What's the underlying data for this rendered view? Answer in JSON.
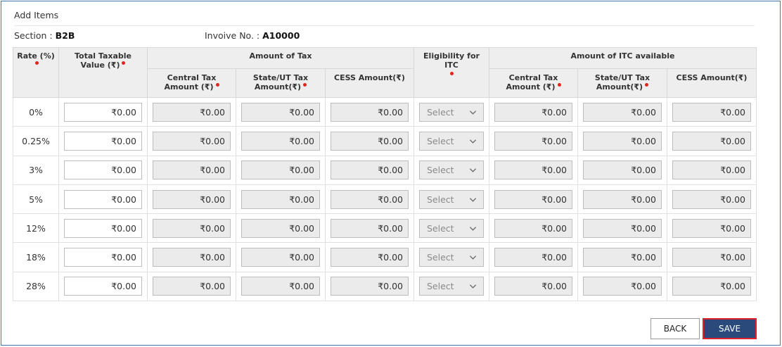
{
  "panel": {
    "title": "Add Items"
  },
  "meta": {
    "section_label": "Section : ",
    "section_value": "B2B",
    "invoice_label": "Invoive No. : ",
    "invoice_value": "A10000"
  },
  "columns": {
    "rate": "Rate (%)",
    "taxable": "Total Taxable Value (₹)",
    "amount_of_tax": "Amount of Tax",
    "eligibility": "Eligibility for ITC",
    "itc_available": "Amount of ITC available",
    "central_tax": "Central Tax Amount (₹)",
    "state_tax": "State/UT Tax Amount(₹)",
    "cess": "CESS Amount(₹)",
    "itc_central_tax": "Central Tax Amount (₹)",
    "itc_state_tax": "State/UT Tax Amount(₹)",
    "itc_cess": "CESS Amount(₹)"
  },
  "rows": [
    {
      "rate": "0%",
      "taxable": "₹0.00",
      "central": "₹0.00",
      "state": "₹0.00",
      "cess": "₹0.00",
      "eligibility": "Select",
      "itc_central": "₹0.00",
      "itc_state": "₹0.00",
      "itc_cess": "₹0.00"
    },
    {
      "rate": "0.25%",
      "taxable": "₹0.00",
      "central": "₹0.00",
      "state": "₹0.00",
      "cess": "₹0.00",
      "eligibility": "Select",
      "itc_central": "₹0.00",
      "itc_state": "₹0.00",
      "itc_cess": "₹0.00"
    },
    {
      "rate": "3%",
      "taxable": "₹0.00",
      "central": "₹0.00",
      "state": "₹0.00",
      "cess": "₹0.00",
      "eligibility": "Select",
      "itc_central": "₹0.00",
      "itc_state": "₹0.00",
      "itc_cess": "₹0.00"
    },
    {
      "rate": "5%",
      "taxable": "₹0.00",
      "central": "₹0.00",
      "state": "₹0.00",
      "cess": "₹0.00",
      "eligibility": "Select",
      "itc_central": "₹0.00",
      "itc_state": "₹0.00",
      "itc_cess": "₹0.00"
    },
    {
      "rate": "12%",
      "taxable": "₹0.00",
      "central": "₹0.00",
      "state": "₹0.00",
      "cess": "₹0.00",
      "eligibility": "Select",
      "itc_central": "₹0.00",
      "itc_state": "₹0.00",
      "itc_cess": "₹0.00"
    },
    {
      "rate": "18%",
      "taxable": "₹0.00",
      "central": "₹0.00",
      "state": "₹0.00",
      "cess": "₹0.00",
      "eligibility": "Select",
      "itc_central": "₹0.00",
      "itc_state": "₹0.00",
      "itc_cess": "₹0.00"
    },
    {
      "rate": "28%",
      "taxable": "₹0.00",
      "central": "₹0.00",
      "state": "₹0.00",
      "cess": "₹0.00",
      "eligibility": "Select",
      "itc_central": "₹0.00",
      "itc_state": "₹0.00",
      "itc_cess": "₹0.00"
    }
  ],
  "buttons": {
    "back": "BACK",
    "save": "SAVE"
  },
  "colors": {
    "required_dot": "#e1251b",
    "save_bg": "#2b4a7c",
    "save_highlight": "#e0202a",
    "frame_border": "#4a73a8"
  },
  "icons": {
    "dropdown": "chevron-down-icon",
    "required": "required-dot-icon"
  }
}
